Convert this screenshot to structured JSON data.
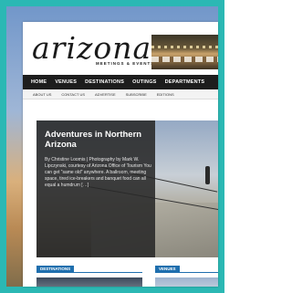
{
  "site": {
    "logo": "arizona",
    "logo_sub": "MEETINGS & EVENTS"
  },
  "nav": {
    "items": [
      "HOME",
      "VENUES",
      "DESTINATIONS",
      "OUTINGS",
      "DEPARTMENTS"
    ]
  },
  "subnav": {
    "items": [
      "ABOUT US",
      "CONTACT US",
      "ADVERTISE",
      "SUBSCRIBE",
      "EDITIONS"
    ]
  },
  "feature": {
    "title": "Adventures in Northern Arizona",
    "body": "By Christine Loomis | Photography by Mark W. Lipczynski, courtesy of Arizona Office of Tourism You can get “same old” anywhere. A ballroom, meeting space, tired ice-breakers and banquet food can all equal a humdrum […]"
  },
  "sections": {
    "destinations": "DESTINATIONS",
    "venues": "VENUES"
  },
  "colors": {
    "frame": "#2bb8b4",
    "nav_bg": "#1d1d1d",
    "section_label": "#1f6fae"
  }
}
